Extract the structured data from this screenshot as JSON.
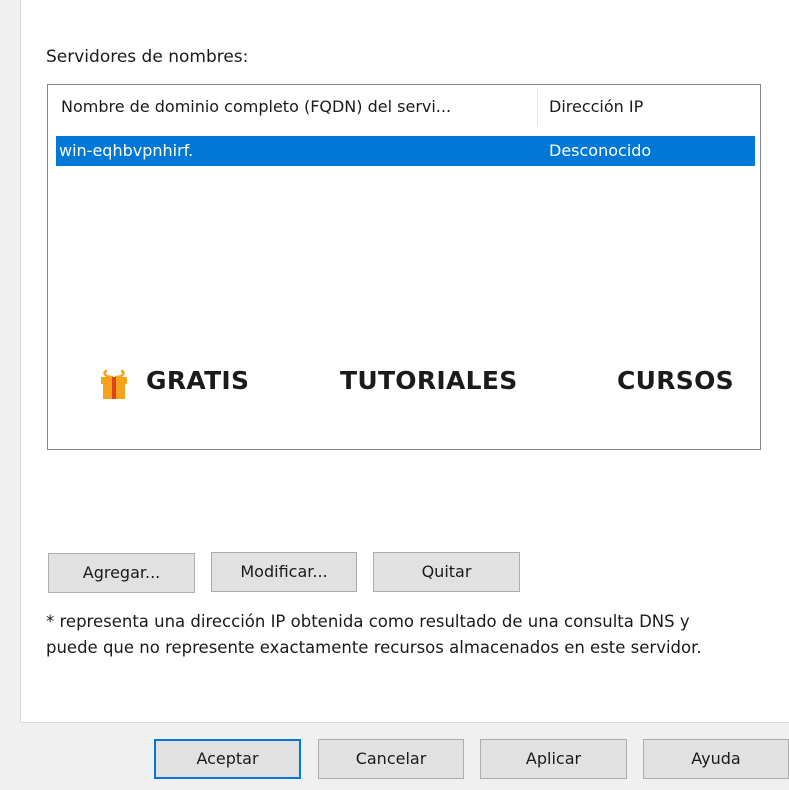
{
  "section_label": "Servidores de nombres:",
  "listview": {
    "columns": [
      "Nombre de dominio completo (FQDN) del servi...",
      "Dirección IP"
    ],
    "rows": [
      {
        "fqdn": "win-eqhbvpnhirf.",
        "ip": "Desconocido",
        "selected": true
      }
    ]
  },
  "overlay": {
    "gift_icon": "gift-icon",
    "items": [
      "GRATIS",
      "TUTORIALES",
      "CURSOS"
    ]
  },
  "actions": {
    "add": "Agregar...",
    "edit": "Modificar...",
    "remove": "Quitar"
  },
  "note": "* representa una dirección IP obtenida como resultado de una consulta DNS y puede que no represente exactamente recursos almacenados en este servidor.",
  "dialog_buttons": {
    "ok": "Aceptar",
    "cancel": "Cancelar",
    "apply": "Aplicar",
    "help": "Ayuda"
  },
  "colors": {
    "selection": "#0078d7",
    "button_face": "#e1e1e1",
    "gift": "#f7a21b"
  }
}
